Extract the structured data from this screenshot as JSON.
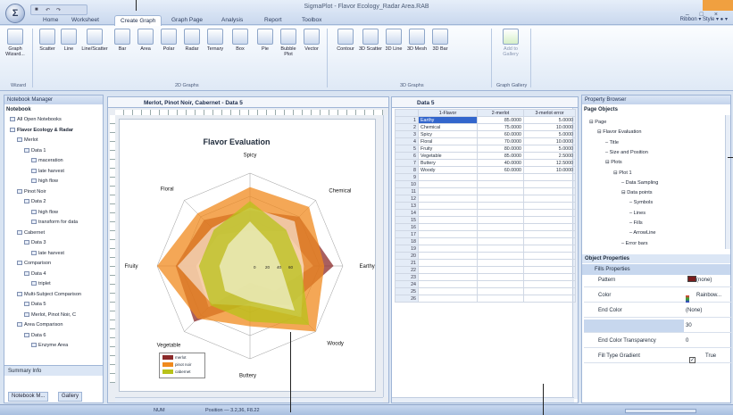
{
  "app": {
    "title": "SigmaPlot - Flavor Ecology_Radar Area.RAB",
    "orb_label": "Σ",
    "window_controls": "– □ ×"
  },
  "ribbon_tabs": [
    "Home",
    "Worksheet",
    "Create Graph",
    "Graph Page",
    "Analysis",
    "Report",
    "Toolbox"
  ],
  "ribbon_right": "Ribbon ▾  Style ▾  ● ▾",
  "ribbon": {
    "buttons": [
      "Graph Wizard...",
      "Scatter",
      "Line",
      "Line/Scatter",
      "Bar",
      "Area",
      "Polar",
      "Radar",
      "Ternary",
      "Box",
      "Pie",
      "Bubble Plot",
      "Vector",
      "Contour",
      "3D Scatter",
      "3D Line",
      "3D Mesh",
      "3D Bar",
      "Add to Gallery"
    ],
    "groups": [
      "Wizard",
      "2D Graphs",
      "3D Graphs",
      "Graph Gallery"
    ]
  },
  "notebook": {
    "header": "Notebook Manager",
    "subheader": "Notebook",
    "tree": [
      "All Open Notebooks",
      "Flavor Ecology & Radar",
      "Merlot",
      "Data 1",
      "maceration",
      "late harvest",
      "high flow",
      "Pinot Noir",
      "Data 2",
      "high flow",
      "transform for data",
      "Cabernet",
      "Data 3",
      "late harvest",
      "Comparison",
      "Data 4",
      "triplet",
      "Multi-Subject Comparison",
      "Data 5",
      "Merlot, Pinot Noir, C",
      "Area Comparison",
      "Data 6",
      "Enzyme Area"
    ],
    "summary": "Summary Info",
    "bottom_tabs": [
      "Notebook M...",
      "Gallery"
    ]
  },
  "graph": {
    "tab": "Merlot, Pinot Noir, Cabernet - Data 5",
    "title": "Flavor Evaluation",
    "axes": [
      "Spicy",
      "Chemical",
      "Earthy",
      "Woody",
      "Buttery",
      "Vegetable",
      "Fruity",
      "Floral"
    ],
    "ticks": [
      "0",
      "20",
      "40",
      "60"
    ],
    "legend": [
      "merlot",
      "pinot noir",
      "cabernet"
    ]
  },
  "chart_data": {
    "type": "radar",
    "title": "Flavor Evaluation",
    "categories": [
      "Spicy",
      "Chemical",
      "Earthy",
      "Woody",
      "Buttery",
      "Vegetable",
      "Fruity",
      "Floral"
    ],
    "rlim": [
      0,
      100
    ],
    "series": [
      {
        "name": "merlot",
        "values": [
          60,
          75,
          90,
          60,
          40,
          85,
          80,
          70
        ]
      },
      {
        "name": "pinot noir",
        "values": [
          85,
          90,
          80,
          100,
          65,
          80,
          100,
          80
        ]
      },
      {
        "name": "cabernet",
        "values": [
          70,
          55,
          55,
          90,
          60,
          60,
          55,
          55
        ]
      }
    ],
    "colors": [
      "#8b2a2a",
      "#f08a1e",
      "#b8c21a"
    ]
  },
  "worksheet": {
    "tab": "Data 5",
    "columns": [
      "1-Flavor",
      "2-merlot",
      "3-merlot error"
    ],
    "rows": [
      [
        "1",
        "Earthy",
        "85.0000",
        "5.0000"
      ],
      [
        "2",
        "Chemical",
        "75.0000",
        "10.0000"
      ],
      [
        "3",
        "Spicy",
        "60.0000",
        "5.0000"
      ],
      [
        "4",
        "Floral",
        "70.0000",
        "10.0000"
      ],
      [
        "5",
        "Fruity",
        "80.0000",
        "5.0000"
      ],
      [
        "6",
        "Vegetable",
        "85.0000",
        "2.5000"
      ],
      [
        "7",
        "Buttery",
        "40.0000",
        "12.5000"
      ],
      [
        "8",
        "Woody",
        "60.0000",
        "10.0000"
      ],
      [
        "9",
        "",
        "",
        ""
      ],
      [
        "10",
        "",
        "",
        ""
      ],
      [
        "11",
        "",
        "",
        ""
      ],
      [
        "12",
        "",
        "",
        ""
      ],
      [
        "13",
        "",
        "",
        ""
      ],
      [
        "14",
        "",
        "",
        ""
      ],
      [
        "15",
        "",
        "",
        ""
      ],
      [
        "16",
        "",
        "",
        ""
      ],
      [
        "17",
        "",
        "",
        ""
      ],
      [
        "18",
        "",
        "",
        ""
      ],
      [
        "19",
        "",
        "",
        ""
      ],
      [
        "20",
        "",
        "",
        ""
      ],
      [
        "21",
        "",
        "",
        ""
      ],
      [
        "22",
        "",
        "",
        ""
      ],
      [
        "23",
        "",
        "",
        ""
      ],
      [
        "24",
        "",
        "",
        ""
      ],
      [
        "25",
        "",
        "",
        ""
      ],
      [
        "26",
        "",
        "",
        ""
      ]
    ]
  },
  "property_browser": {
    "header": "Property Browser",
    "page_objects": "Page Objects",
    "tree": [
      "Page",
      "Flavor Evaluation",
      "Title",
      "Size and Position",
      "Plots",
      "Plot 1",
      "Data Sampling",
      "Data points",
      "Symbols",
      "Lines",
      "Fills",
      "ArrowLine",
      "Error bars"
    ],
    "object_props": "Object Properties",
    "fill_props": "Fills Properties",
    "props": [
      {
        "k": "Pattern",
        "v": "(none)"
      },
      {
        "k": "Color",
        "v": "Rainbow..."
      },
      {
        "k": "End Color",
        "v": "(None)"
      },
      {
        "k": "Color Transparency",
        "v": "30"
      },
      {
        "k": "End Color Transparency",
        "v": "0"
      },
      {
        "k": "Fill Type Gradient",
        "v": "True"
      }
    ]
  },
  "status": {
    "mode": "NUM",
    "position": "Position — 3.2,36, F8.22"
  }
}
